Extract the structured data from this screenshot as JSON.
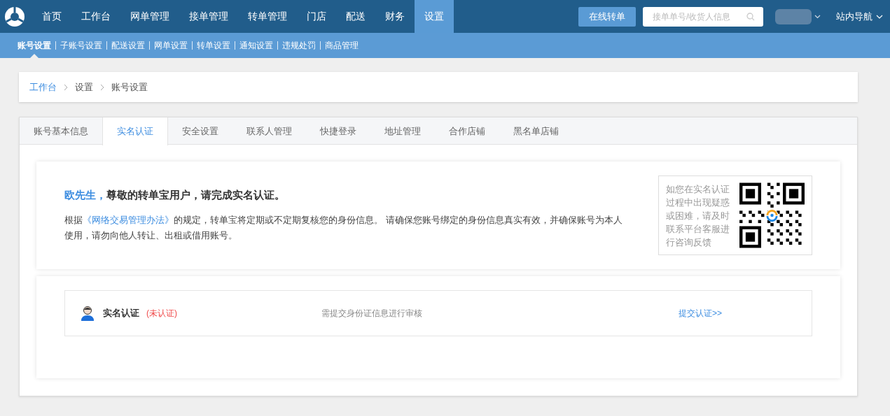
{
  "top_nav": {
    "items": [
      {
        "label": "首页",
        "selected": false
      },
      {
        "label": "工作台",
        "selected": false
      },
      {
        "label": "网单管理",
        "selected": false
      },
      {
        "label": "接单管理",
        "selected": false
      },
      {
        "label": "转单管理",
        "selected": false
      },
      {
        "label": "门店",
        "selected": false
      },
      {
        "label": "配送",
        "selected": false
      },
      {
        "label": "财务",
        "selected": false
      },
      {
        "label": "设置",
        "selected": true
      }
    ],
    "action_button": "在线转单",
    "search": {
      "placeholder": "接单单号/收货人信息"
    },
    "site_nav": "站内导航"
  },
  "sub_nav": [
    {
      "label": "账号设置",
      "selected": true
    },
    {
      "label": "子账号设置",
      "selected": false
    },
    {
      "label": "配送设置",
      "selected": false
    },
    {
      "label": "网单设置",
      "selected": false
    },
    {
      "label": "转单设置",
      "selected": false
    },
    {
      "label": "通知设置",
      "selected": false
    },
    {
      "label": "违规处罚",
      "selected": false
    },
    {
      "label": "商品管理",
      "selected": false
    }
  ],
  "breadcrumb": [
    "工作台",
    "设置",
    "账号设置"
  ],
  "tabs": [
    {
      "label": "账号基本信息",
      "selected": false
    },
    {
      "label": "实名认证",
      "selected": true
    },
    {
      "label": "安全设置",
      "selected": false
    },
    {
      "label": "联系人管理",
      "selected": false
    },
    {
      "label": "快捷登录",
      "selected": false
    },
    {
      "label": "地址管理",
      "selected": false
    },
    {
      "label": "合作店铺",
      "selected": false
    },
    {
      "label": "黑名单店铺",
      "selected": false
    }
  ],
  "notice": {
    "name": "欧先生，",
    "greeting": "尊敬的转单宝用户，请完成实名认证。",
    "text_before": "根据",
    "link": "《网络交易管理办法》",
    "text_after": "的规定，转单宝将定期或不定期复核您的身份信息。 请确保您账号绑定的身份信息真实有效，并确保账号为本人使用，请勿向他人转让、出租或借用账号。",
    "help": "如您在实名认证过程中出现疑惑或困难，请及时联系平台客服进行咨询反馈"
  },
  "verification": {
    "title": "实名认证",
    "status": "(未认证)",
    "verified": false,
    "hint": "需提交身份证信息进行审核",
    "action": "提交认证>>"
  }
}
